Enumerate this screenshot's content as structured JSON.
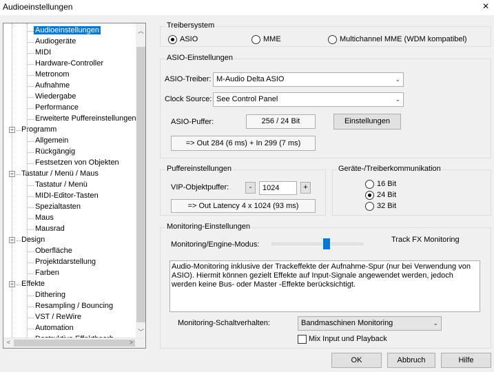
{
  "window": {
    "title": "Audioeinstellungen",
    "close_icon": "×"
  },
  "tree": {
    "items": [
      {
        "label": "Audioeinstellungen",
        "level": 1,
        "selected": true
      },
      {
        "label": "Audiogeräte",
        "level": 1
      },
      {
        "label": "MIDI",
        "level": 1
      },
      {
        "label": "Hardware-Controller",
        "level": 1
      },
      {
        "label": "Metronom",
        "level": 1
      },
      {
        "label": "Aufnahme",
        "level": 1
      },
      {
        "label": "Wiedergabe",
        "level": 1
      },
      {
        "label": "Performance",
        "level": 1
      },
      {
        "label": "Erweiterte Puffereinstellungen",
        "level": 1
      },
      {
        "label": "Programm",
        "level": 0
      },
      {
        "label": "Allgemein",
        "level": 1
      },
      {
        "label": "Rückgängig",
        "level": 1
      },
      {
        "label": "Festsetzen von Objekten",
        "level": 1
      },
      {
        "label": "Tastatur / Menü / Maus",
        "level": 0
      },
      {
        "label": "Tastatur / Menü",
        "level": 1
      },
      {
        "label": "MIDI-Editor-Tasten",
        "level": 1
      },
      {
        "label": "Spezialtasten",
        "level": 1
      },
      {
        "label": "Maus",
        "level": 1
      },
      {
        "label": "Mausrad",
        "level": 1
      },
      {
        "label": "Design",
        "level": 0
      },
      {
        "label": "Oberfläche",
        "level": 1
      },
      {
        "label": "Projektdarstellung",
        "level": 1
      },
      {
        "label": "Farben",
        "level": 1
      },
      {
        "label": "Effekte",
        "level": 0
      },
      {
        "label": "Dithering",
        "level": 1
      },
      {
        "label": "Resampling / Bouncing",
        "level": 1
      },
      {
        "label": "VST / ReWire",
        "level": 1
      },
      {
        "label": "Automation",
        "level": 1
      },
      {
        "label": "Destruktive Effektbearb.",
        "level": 1
      }
    ]
  },
  "treiber": {
    "label": "Treibersystem",
    "options": [
      "ASIO",
      "MME",
      "Multichannel MME (WDM kompatibel)"
    ],
    "selected": "ASIO"
  },
  "asio": {
    "label": "ASIO-Einstellungen",
    "driver_label": "ASIO-Treiber:",
    "driver_value": "M-Audio Delta ASIO",
    "clock_label": "Clock Source:",
    "clock_value": "See Control Panel",
    "buffer_label": "ASIO-Puffer:",
    "buffer_value": "256 / 24 Bit",
    "settings_button": "Einstellungen",
    "latency": "=> Out 284 (6 ms) + In 299 (7 ms)"
  },
  "puffer": {
    "label": "Puffereinstellungen",
    "vip_label": "VIP-Objektpuffer:",
    "minus": "-",
    "value": "1024",
    "plus": "+",
    "latency": "=> Out Latency 4 x 1024 (93 ms)"
  },
  "geraete": {
    "label": "Geräte-/Treiberkommunikation",
    "options": [
      "16 Bit",
      "24 Bit",
      "32 Bit"
    ],
    "selected": "24 Bit"
  },
  "monitoring": {
    "label": "Monitoring-Einstellungen",
    "mode_label": "Monitoring/Engine-Modus:",
    "mode_value": "Track FX Monitoring",
    "slider_fraction": 0.6,
    "description": "Audio-Monitoring inklusive der Trackeffekte der Aufnahme-Spur (nur bei Verwendung von ASIO). Hiermit können gezielt Effekte auf Input-Signale angewendet werden, jedoch werden keine Bus- oder Master -Effekte berücksichtigt.",
    "behavior_label": "Monitoring-Schaltverhalten:",
    "behavior_value": "Bandmaschinen Monitoring",
    "mix_label": "Mix Input und Playback",
    "mix_checked": false
  },
  "buttons": {
    "ok": "OK",
    "cancel": "Abbruch",
    "help": "Hilfe"
  },
  "icons": {
    "chevron_down": "⌄",
    "arrow_up": "▲",
    "arrow_down": "▼",
    "arrow_left": "◀",
    "arrow_right": "▶",
    "minus_box": "−"
  }
}
